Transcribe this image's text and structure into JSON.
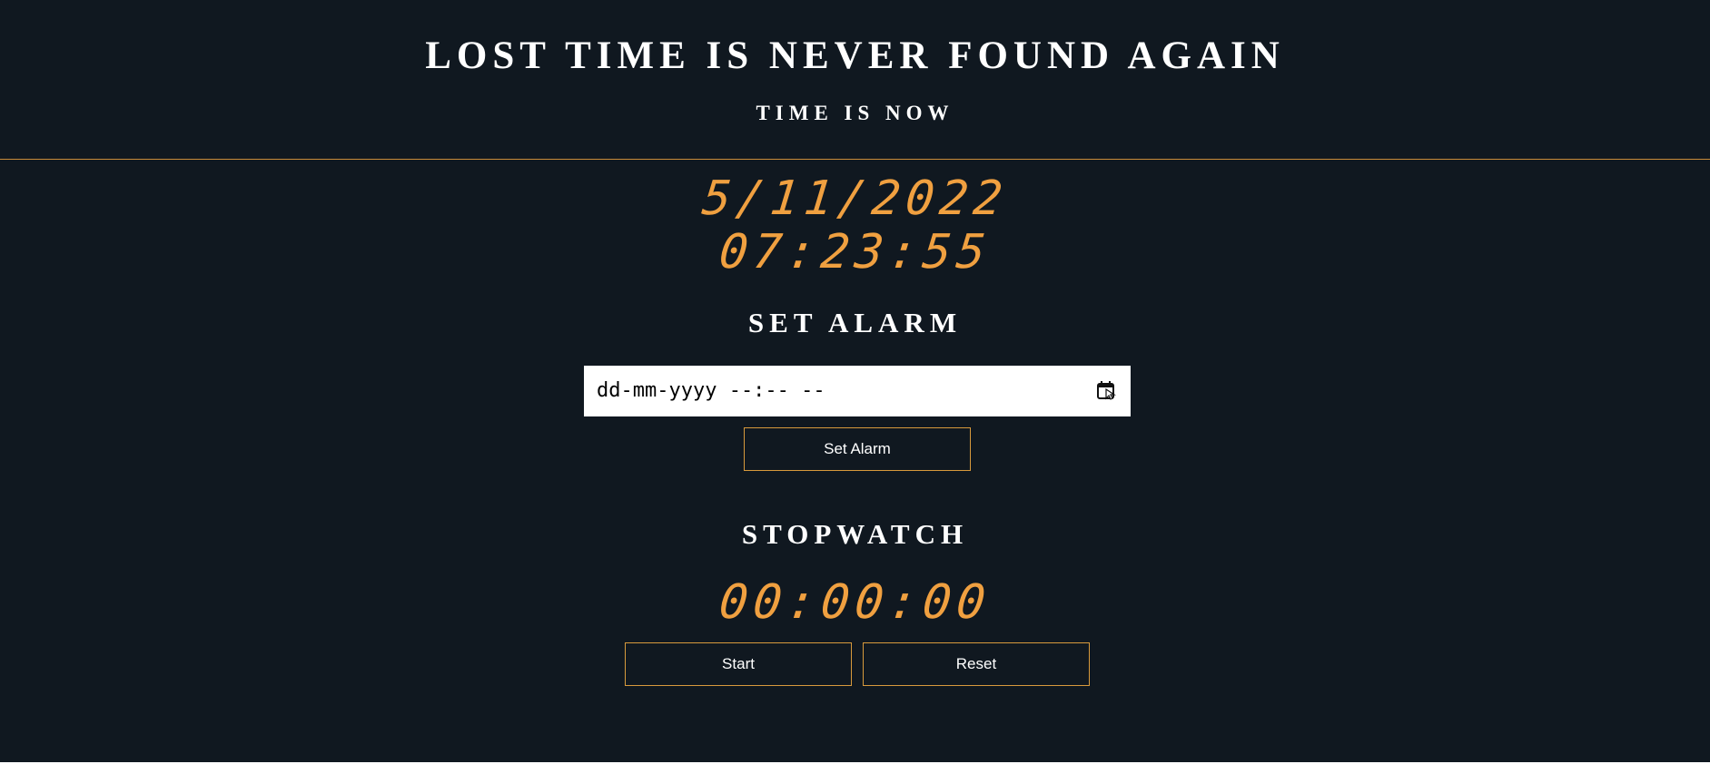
{
  "header": {
    "title": "LOST TIME IS NEVER FOUND AGAIN",
    "subtitle": "TIME IS NOW"
  },
  "clock": {
    "date": "5/11/2022",
    "time": "07:23:55"
  },
  "alarm": {
    "title": "SET ALARM",
    "input_placeholder": "dd-mm-yyyy --:-- --",
    "button_label": "Set Alarm",
    "icon": "calendar-icon"
  },
  "stopwatch": {
    "title": "STOPWATCH",
    "display": "00:00:00",
    "start_label": "Start",
    "reset_label": "Reset"
  },
  "colors": {
    "background": "#101820",
    "accent": "#f0a040",
    "border": "#d89a3c",
    "text": "#ffffff"
  }
}
